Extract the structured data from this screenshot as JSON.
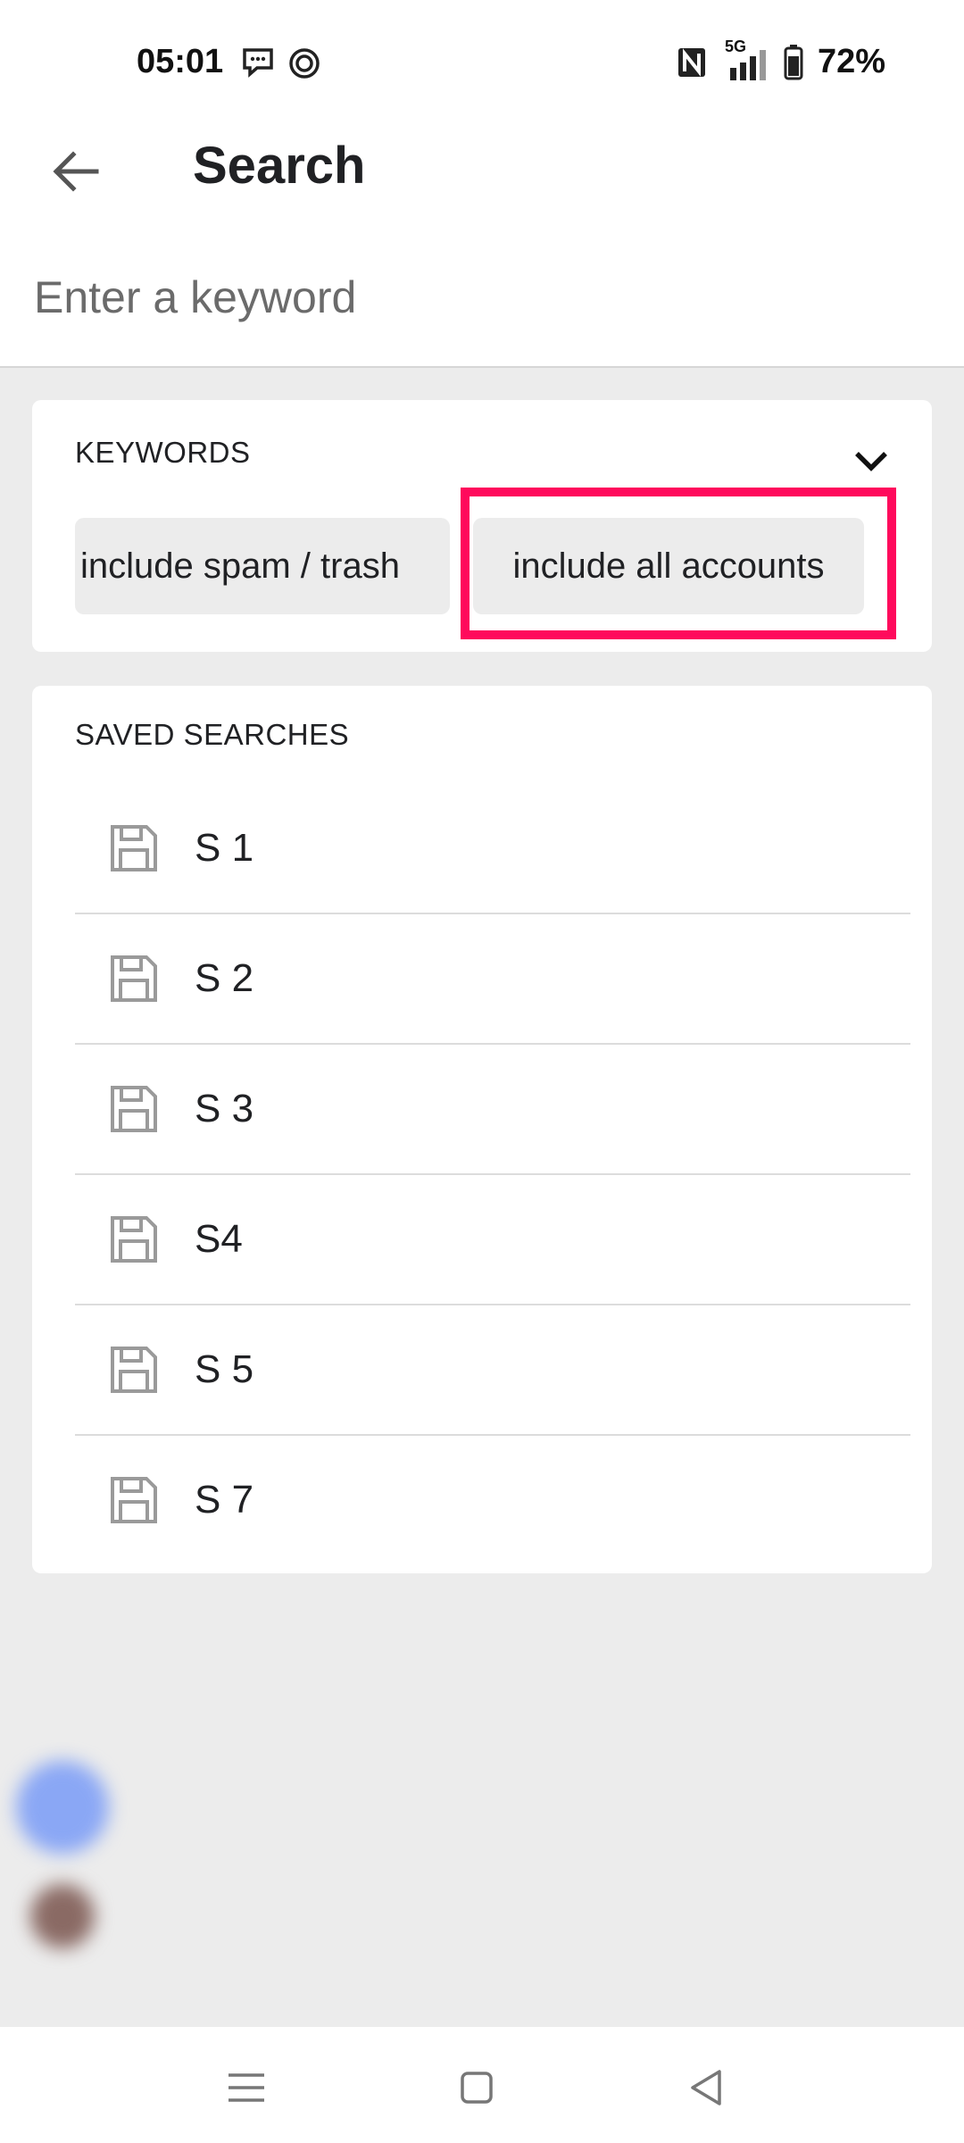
{
  "status_bar": {
    "time": "05:01",
    "network": "5G",
    "battery": "72%",
    "icons": [
      "chat-notification-icon",
      "sync-icon",
      "nfc-icon",
      "signal-icon",
      "battery-icon"
    ]
  },
  "header": {
    "title": "Search",
    "back_icon": "arrow-left-icon"
  },
  "search": {
    "placeholder": "Enter a keyword",
    "value": ""
  },
  "keywords": {
    "title": "KEYWORDS",
    "expand_icon": "chevron-down-icon",
    "chips": [
      {
        "label": "include spam / trash"
      },
      {
        "label": "include all accounts",
        "highlighted": true
      }
    ]
  },
  "saved_searches": {
    "title": "SAVED SEARCHES",
    "item_icon": "floppy-disk-icon",
    "items": [
      {
        "label": "S 1"
      },
      {
        "label": "S 2"
      },
      {
        "label": "S 3"
      },
      {
        "label": "S4"
      },
      {
        "label": "S 5"
      },
      {
        "label": "S 7"
      }
    ]
  },
  "colors": {
    "highlight": "#ff0a5c",
    "background": "#ececec",
    "card": "#ffffff",
    "chip": "#ececec"
  },
  "nav": {
    "buttons": [
      "menu-icon",
      "home-square-icon",
      "back-triangle-icon"
    ]
  }
}
